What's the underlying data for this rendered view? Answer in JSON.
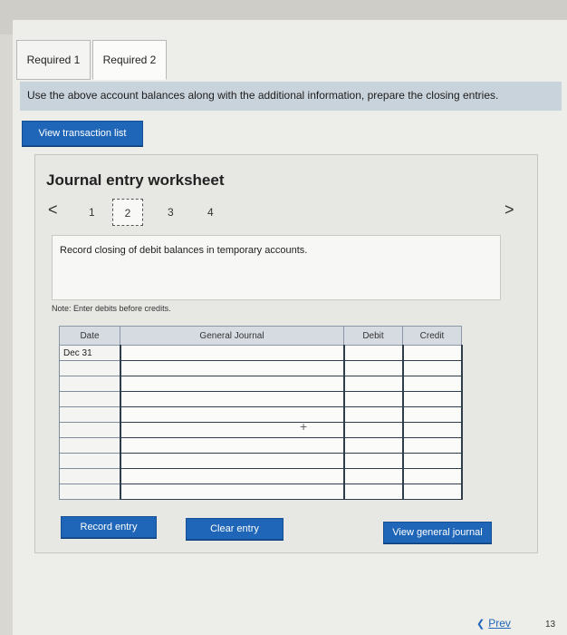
{
  "tabs": [
    {
      "label": "Required 1"
    },
    {
      "label": "Required 2"
    }
  ],
  "instruction": "Use the above account balances along with the additional information, prepare the closing entries.",
  "view_button": "View transaction list",
  "worksheet": {
    "title": "Journal entry worksheet",
    "nav": {
      "prev": "<",
      "next": ">",
      "pages": [
        "1",
        "2",
        "3",
        "4"
      ],
      "active": "2"
    },
    "record_text": "Record closing of debit balances in temporary accounts.",
    "note": "Note: Enter debits before credits.",
    "table": {
      "headers": {
        "date": "Date",
        "general_journal": "General Journal",
        "debit": "Debit",
        "credit": "Credit"
      },
      "first_row_date": "Dec 31"
    },
    "buttons": {
      "record": "Record entry",
      "clear": "Clear entry",
      "view_general": "View general journal"
    }
  },
  "footer": {
    "prev": "Prev",
    "page_number": "13"
  }
}
